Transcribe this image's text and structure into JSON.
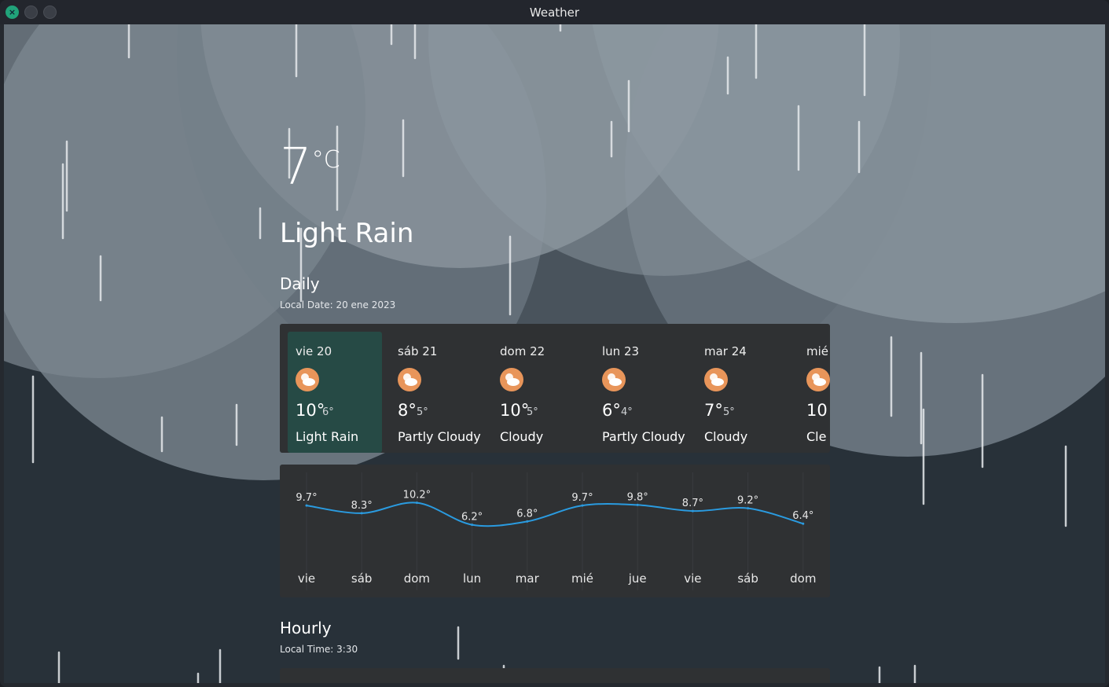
{
  "window": {
    "title": "Weather"
  },
  "current": {
    "temperature": "7",
    "unit": "°C",
    "condition": "Light Rain"
  },
  "daily": {
    "heading": "Daily",
    "local_date": "Local Date: 20 ene 2023",
    "days": [
      {
        "name": "vie 20",
        "hi": "10°",
        "lo": "6°",
        "desc": "Light Rain",
        "icon": "partly-cloudy-icon",
        "selected": true
      },
      {
        "name": "sáb 21",
        "hi": "8°",
        "lo": "5°",
        "desc": "Partly Cloudy",
        "icon": "partly-cloudy-icon"
      },
      {
        "name": "dom 22",
        "hi": "10°",
        "lo": "5°",
        "desc": "Cloudy",
        "icon": "partly-cloudy-icon"
      },
      {
        "name": "lun 23",
        "hi": "6°",
        "lo": "4°",
        "desc": "Partly Cloudy",
        "icon": "partly-cloudy-icon"
      },
      {
        "name": "mar 24",
        "hi": "7°",
        "lo": "5°",
        "desc": "Cloudy",
        "icon": "partly-cloudy-icon"
      },
      {
        "name": "mié",
        "hi": "10",
        "lo": "",
        "desc": "Cle",
        "icon": "partly-cloudy-icon"
      }
    ]
  },
  "chart_data": {
    "type": "line",
    "categories": [
      "vie",
      "sáb",
      "dom",
      "lun",
      "mar",
      "mié",
      "jue",
      "vie",
      "sáb",
      "dom"
    ],
    "values": [
      9.7,
      8.3,
      10.2,
      6.2,
      6.8,
      9.7,
      9.8,
      8.7,
      9.2,
      6.4
    ],
    "labels": [
      "9.7°",
      "8.3°",
      "10.2°",
      "6.2°",
      "6.8°",
      "9.7°",
      "9.8°",
      "8.7°",
      "9.2°",
      "6.4°"
    ],
    "ylim": [
      5,
      11
    ],
    "color": "#2a9be0"
  },
  "hourly": {
    "heading": "Hourly",
    "local_time": "Local Time: 3:30"
  },
  "colors": {
    "accent": "#2a9be0",
    "selected_day": "#264a45",
    "card": "#2f3133",
    "icon": "#e8955a"
  }
}
